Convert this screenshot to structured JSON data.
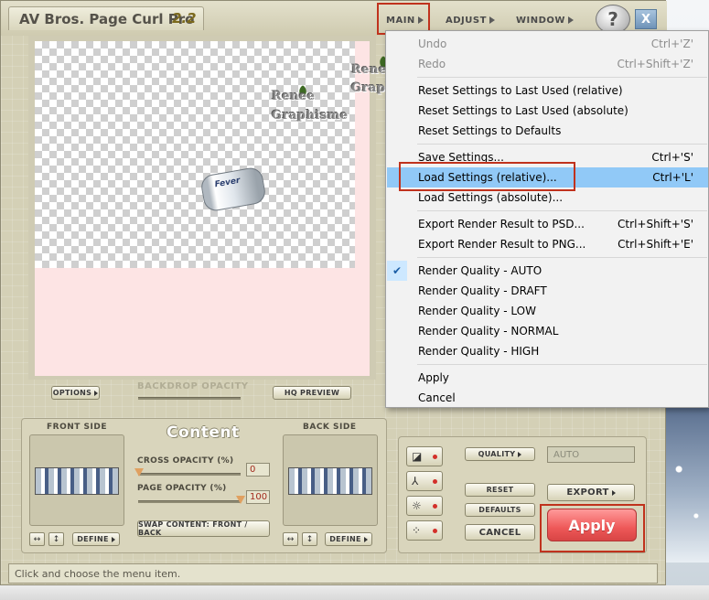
{
  "window": {
    "title": "AV Bros. Page Curl Pro",
    "version": "2.2",
    "menubar": [
      {
        "label": "MAIN"
      },
      {
        "label": "ADJUST"
      },
      {
        "label": "WINDOW"
      }
    ],
    "help_label": "?",
    "close_label": "X"
  },
  "preview": {
    "watermark_line1": "Renee",
    "watermark_line2": "Graphisme",
    "can_text": "Fever"
  },
  "strip": {
    "options_label": "OPTIONS",
    "backdrop_opacity_label": "BACKDROP OPACITY",
    "hq_preview_label": "HQ PREVIEW"
  },
  "front_side": {
    "title": "FRONT SIDE",
    "flip_h": "↔",
    "flip_v": "↕",
    "define_label": "DEFINE"
  },
  "content": {
    "title": "Content",
    "cross_opacity_label": "CROSS OPACITY (%)",
    "cross_opacity_value": "0",
    "page_opacity_label": "PAGE OPACITY (%)",
    "page_opacity_value": "100",
    "swap_label": "SWAP CONTENT: FRONT / BACK"
  },
  "back_side": {
    "title": "BACK SIDE",
    "flip_h": "↔",
    "flip_v": "↕",
    "define_label": "DEFINE"
  },
  "controls": {
    "quality_label": "QUALITY",
    "quality_value": "AUTO",
    "reset_label": "RESET",
    "defaults_label": "DEFAULTS",
    "cancel_label": "CANCEL",
    "export_label": "EXPORT",
    "apply_label": "Apply"
  },
  "status": {
    "text": "Click and choose the menu item."
  },
  "menu": {
    "items": [
      {
        "label": "Undo",
        "shortcut": "Ctrl+'Z'",
        "disabled": true
      },
      {
        "label": "Redo",
        "shortcut": "Ctrl+Shift+'Z'",
        "disabled": true
      },
      {
        "label": "Reset Settings to Last Used (relative)",
        "shortcut": ""
      },
      {
        "label": "Reset Settings to Last Used (absolute)",
        "shortcut": ""
      },
      {
        "label": "Reset Settings to Defaults",
        "shortcut": ""
      },
      {
        "label": "Save Settings...",
        "shortcut": "Ctrl+'S'"
      },
      {
        "label": "Load Settings (relative)...",
        "shortcut": "Ctrl+'L'",
        "highlighted": true
      },
      {
        "label": "Load Settings (absolute)...",
        "shortcut": ""
      },
      {
        "label": "Export Render Result to PSD...",
        "shortcut": "Ctrl+Shift+'S'"
      },
      {
        "label": "Export Render Result to PNG...",
        "shortcut": "Ctrl+Shift+'E'"
      },
      {
        "label": "Render Quality - AUTO",
        "shortcut": "",
        "checked": true
      },
      {
        "label": "Render Quality - DRAFT",
        "shortcut": ""
      },
      {
        "label": "Render Quality - LOW",
        "shortcut": ""
      },
      {
        "label": "Render Quality - NORMAL",
        "shortcut": ""
      },
      {
        "label": "Render Quality - HIGH",
        "shortcut": ""
      },
      {
        "label": "Apply",
        "shortcut": ""
      },
      {
        "label": "Cancel",
        "shortcut": ""
      }
    ]
  },
  "colors": {
    "highlight_border": "#c0321d",
    "menu_hover": "#91c9f7",
    "apply_button": "#ee5858"
  }
}
